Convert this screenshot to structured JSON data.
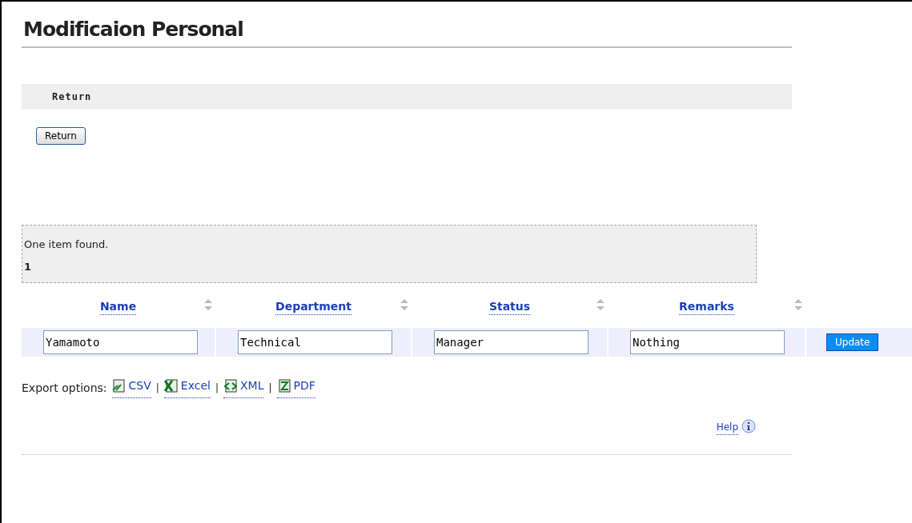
{
  "title": "Modificaion Personal",
  "section": {
    "heading": "Return",
    "button": "Return"
  },
  "result": {
    "message": "One item found.",
    "pages": "1"
  },
  "table": {
    "columns": [
      {
        "label": "Name"
      },
      {
        "label": "Department"
      },
      {
        "label": "Status"
      },
      {
        "label": "Remarks"
      }
    ],
    "rows": [
      {
        "values": [
          "Yamamoto",
          "Technical",
          "Manager",
          "Nothing"
        ],
        "action": "Update"
      }
    ]
  },
  "export": {
    "label": "Export options:",
    "separator": "|",
    "options": [
      {
        "kind": "csv",
        "label": "CSV"
      },
      {
        "kind": "excel",
        "label": "Excel"
      },
      {
        "kind": "xml",
        "label": "XML"
      },
      {
        "kind": "pdf",
        "label": "PDF"
      }
    ]
  },
  "help": "Help"
}
